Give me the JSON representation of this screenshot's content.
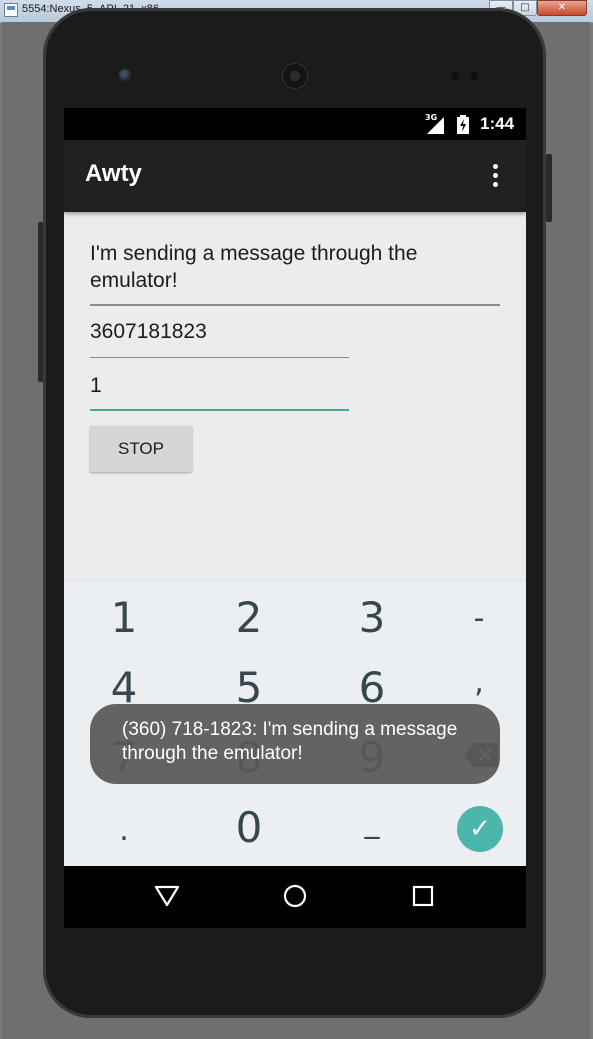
{
  "window": {
    "title": "5554:Nexus_5_API_21_x86",
    "minimize_label": "—",
    "maximize_label": "□",
    "close_label": "✕"
  },
  "status_bar": {
    "network": "3G",
    "time": "1:44"
  },
  "app_bar": {
    "title": "Awty",
    "overflow_icon": "more-vert-icon"
  },
  "form": {
    "message": "I'm sending a message through the emulator!",
    "phone_number": "3607181823",
    "interval": "1",
    "stop_label": "STOP"
  },
  "keyboard": {
    "rows": [
      [
        "1",
        "2",
        "3",
        "-"
      ],
      [
        "4",
        "5",
        "6",
        ","
      ],
      [
        "7",
        "8",
        "9",
        "backspace"
      ],
      [
        ".",
        "0",
        "_",
        "enter"
      ]
    ],
    "accent_color": "#4db6ac"
  },
  "toast": {
    "text": "(360) 718-1823: I'm sending a message through the emulator!"
  },
  "navigation": {
    "back": "back-icon",
    "home": "home-icon",
    "recents": "recents-icon"
  },
  "colors": {
    "app_bar": "#212121",
    "screen_bg": "#ececec",
    "focused_underline": "#4aa596"
  }
}
